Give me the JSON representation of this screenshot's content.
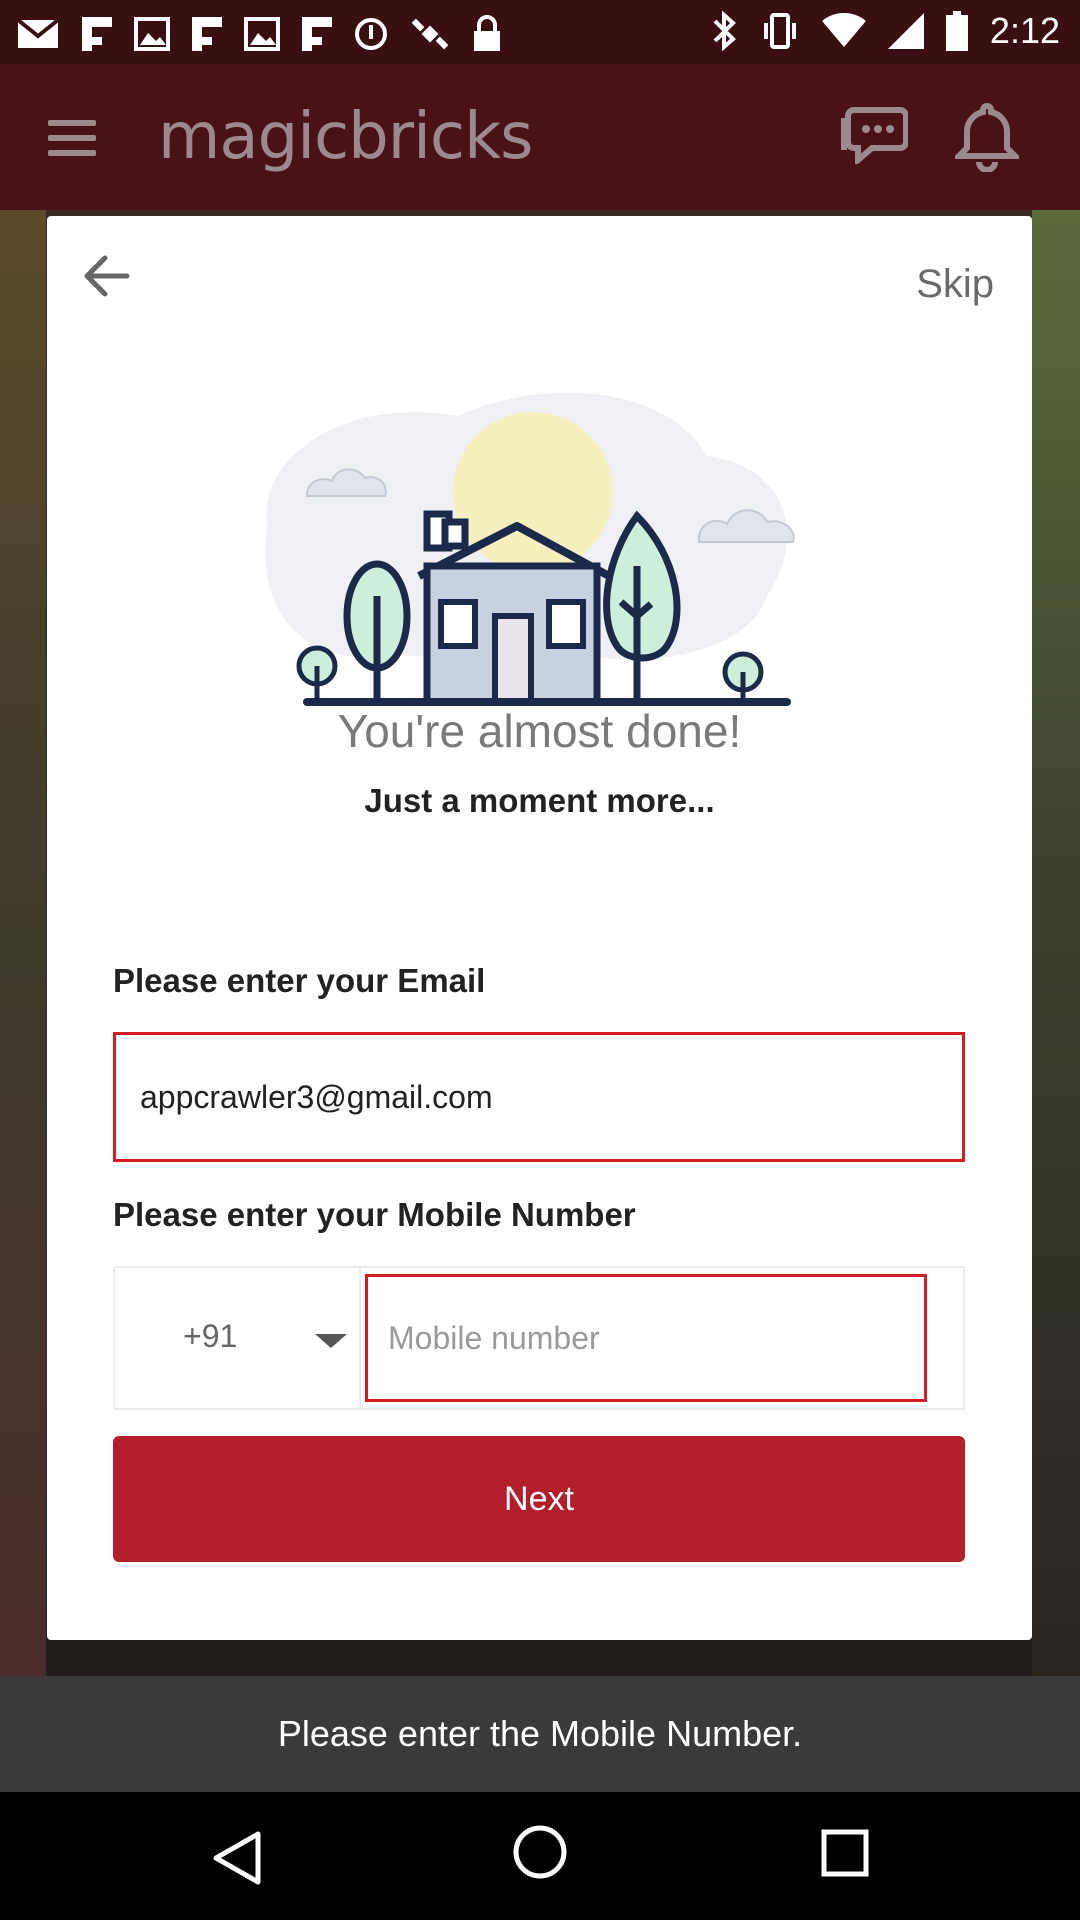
{
  "status_bar": {
    "time": "2:12",
    "icons": [
      "mail-icon",
      "flipboard-icon",
      "image-icon",
      "flipboard-icon",
      "image-icon",
      "flipboard-icon",
      "circle-icon",
      "satellite-icon",
      "lock-icon",
      "bluetooth-icon",
      "vibrate-icon",
      "wifi-icon",
      "signal-icon",
      "battery-icon"
    ]
  },
  "app_bar": {
    "title": "magicbricks",
    "icons": [
      "menu-icon",
      "chat-icon",
      "bell-icon"
    ]
  },
  "modal": {
    "skip_label": "Skip",
    "headline": "You're almost done!",
    "subhead": "Just a moment more...",
    "email": {
      "label": "Please enter your Email",
      "value": "appcrawler3@gmail.com"
    },
    "mobile": {
      "label": "Please enter your Mobile Number",
      "country_code": "+91",
      "placeholder": "Mobile number",
      "value": ""
    },
    "next_label": "Next"
  },
  "toast": {
    "message": "Please enter the Mobile Number."
  },
  "colors": {
    "brand_red": "#b21f2a",
    "field_error_border": "#d21e23",
    "app_bar_bg": "#4a1216"
  }
}
